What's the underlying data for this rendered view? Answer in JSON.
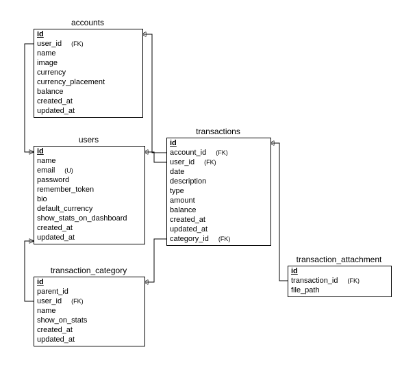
{
  "entities": {
    "accounts": {
      "title": "accounts",
      "fields": [
        {
          "name": "id",
          "pk": true,
          "ann": ""
        },
        {
          "name": "user_id",
          "pk": false,
          "ann": "(FK)"
        },
        {
          "name": "name",
          "pk": false,
          "ann": ""
        },
        {
          "name": "image",
          "pk": false,
          "ann": ""
        },
        {
          "name": "currency",
          "pk": false,
          "ann": ""
        },
        {
          "name": "currency_placement",
          "pk": false,
          "ann": ""
        },
        {
          "name": "balance",
          "pk": false,
          "ann": ""
        },
        {
          "name": "created_at",
          "pk": false,
          "ann": ""
        },
        {
          "name": "updated_at",
          "pk": false,
          "ann": ""
        }
      ]
    },
    "users": {
      "title": "users",
      "fields": [
        {
          "name": "id",
          "pk": true,
          "ann": ""
        },
        {
          "name": "name",
          "pk": false,
          "ann": ""
        },
        {
          "name": "email",
          "pk": false,
          "ann": "(U)"
        },
        {
          "name": "password",
          "pk": false,
          "ann": ""
        },
        {
          "name": "remember_token",
          "pk": false,
          "ann": ""
        },
        {
          "name": "bio",
          "pk": false,
          "ann": ""
        },
        {
          "name": "default_currency",
          "pk": false,
          "ann": ""
        },
        {
          "name": "show_stats_on_dashboard",
          "pk": false,
          "ann": ""
        },
        {
          "name": "created_at",
          "pk": false,
          "ann": ""
        },
        {
          "name": "updated_at",
          "pk": false,
          "ann": ""
        }
      ]
    },
    "transaction_category": {
      "title": "transaction_category",
      "fields": [
        {
          "name": "id",
          "pk": true,
          "ann": ""
        },
        {
          "name": "parent_id",
          "pk": false,
          "ann": ""
        },
        {
          "name": "user_id",
          "pk": false,
          "ann": "(FK)"
        },
        {
          "name": "name",
          "pk": false,
          "ann": ""
        },
        {
          "name": "show_on_stats",
          "pk": false,
          "ann": ""
        },
        {
          "name": "created_at",
          "pk": false,
          "ann": ""
        },
        {
          "name": "updated_at",
          "pk": false,
          "ann": ""
        }
      ]
    },
    "transactions": {
      "title": "transactions",
      "fields": [
        {
          "name": "id",
          "pk": true,
          "ann": ""
        },
        {
          "name": "account_id",
          "pk": false,
          "ann": "(FK)"
        },
        {
          "name": "user_id",
          "pk": false,
          "ann": "(FK)"
        },
        {
          "name": "date",
          "pk": false,
          "ann": ""
        },
        {
          "name": "description",
          "pk": false,
          "ann": ""
        },
        {
          "name": "type",
          "pk": false,
          "ann": ""
        },
        {
          "name": "amount",
          "pk": false,
          "ann": ""
        },
        {
          "name": "balance",
          "pk": false,
          "ann": ""
        },
        {
          "name": "created_at",
          "pk": false,
          "ann": ""
        },
        {
          "name": "updated_at",
          "pk": false,
          "ann": ""
        },
        {
          "name": "category_id",
          "pk": false,
          "ann": "(FK)"
        }
      ]
    },
    "transaction_attachment": {
      "title": "transaction_attachment",
      "fields": [
        {
          "name": "id",
          "pk": true,
          "ann": ""
        },
        {
          "name": "transaction_id",
          "pk": false,
          "ann": "(FK)"
        },
        {
          "name": "file_path",
          "pk": false,
          "ann": ""
        }
      ]
    }
  },
  "chart_data": {
    "type": "erd",
    "relationships": [
      {
        "from": "transactions.account_id",
        "to": "accounts.id"
      },
      {
        "from": "transactions.user_id",
        "to": "users.id"
      },
      {
        "from": "transactions.category_id",
        "to": "transaction_category.id"
      },
      {
        "from": "accounts.user_id",
        "to": "users.id"
      },
      {
        "from": "transaction_category.user_id",
        "to": "users.id"
      },
      {
        "from": "transaction_attachment.transaction_id",
        "to": "transactions.id"
      }
    ]
  }
}
